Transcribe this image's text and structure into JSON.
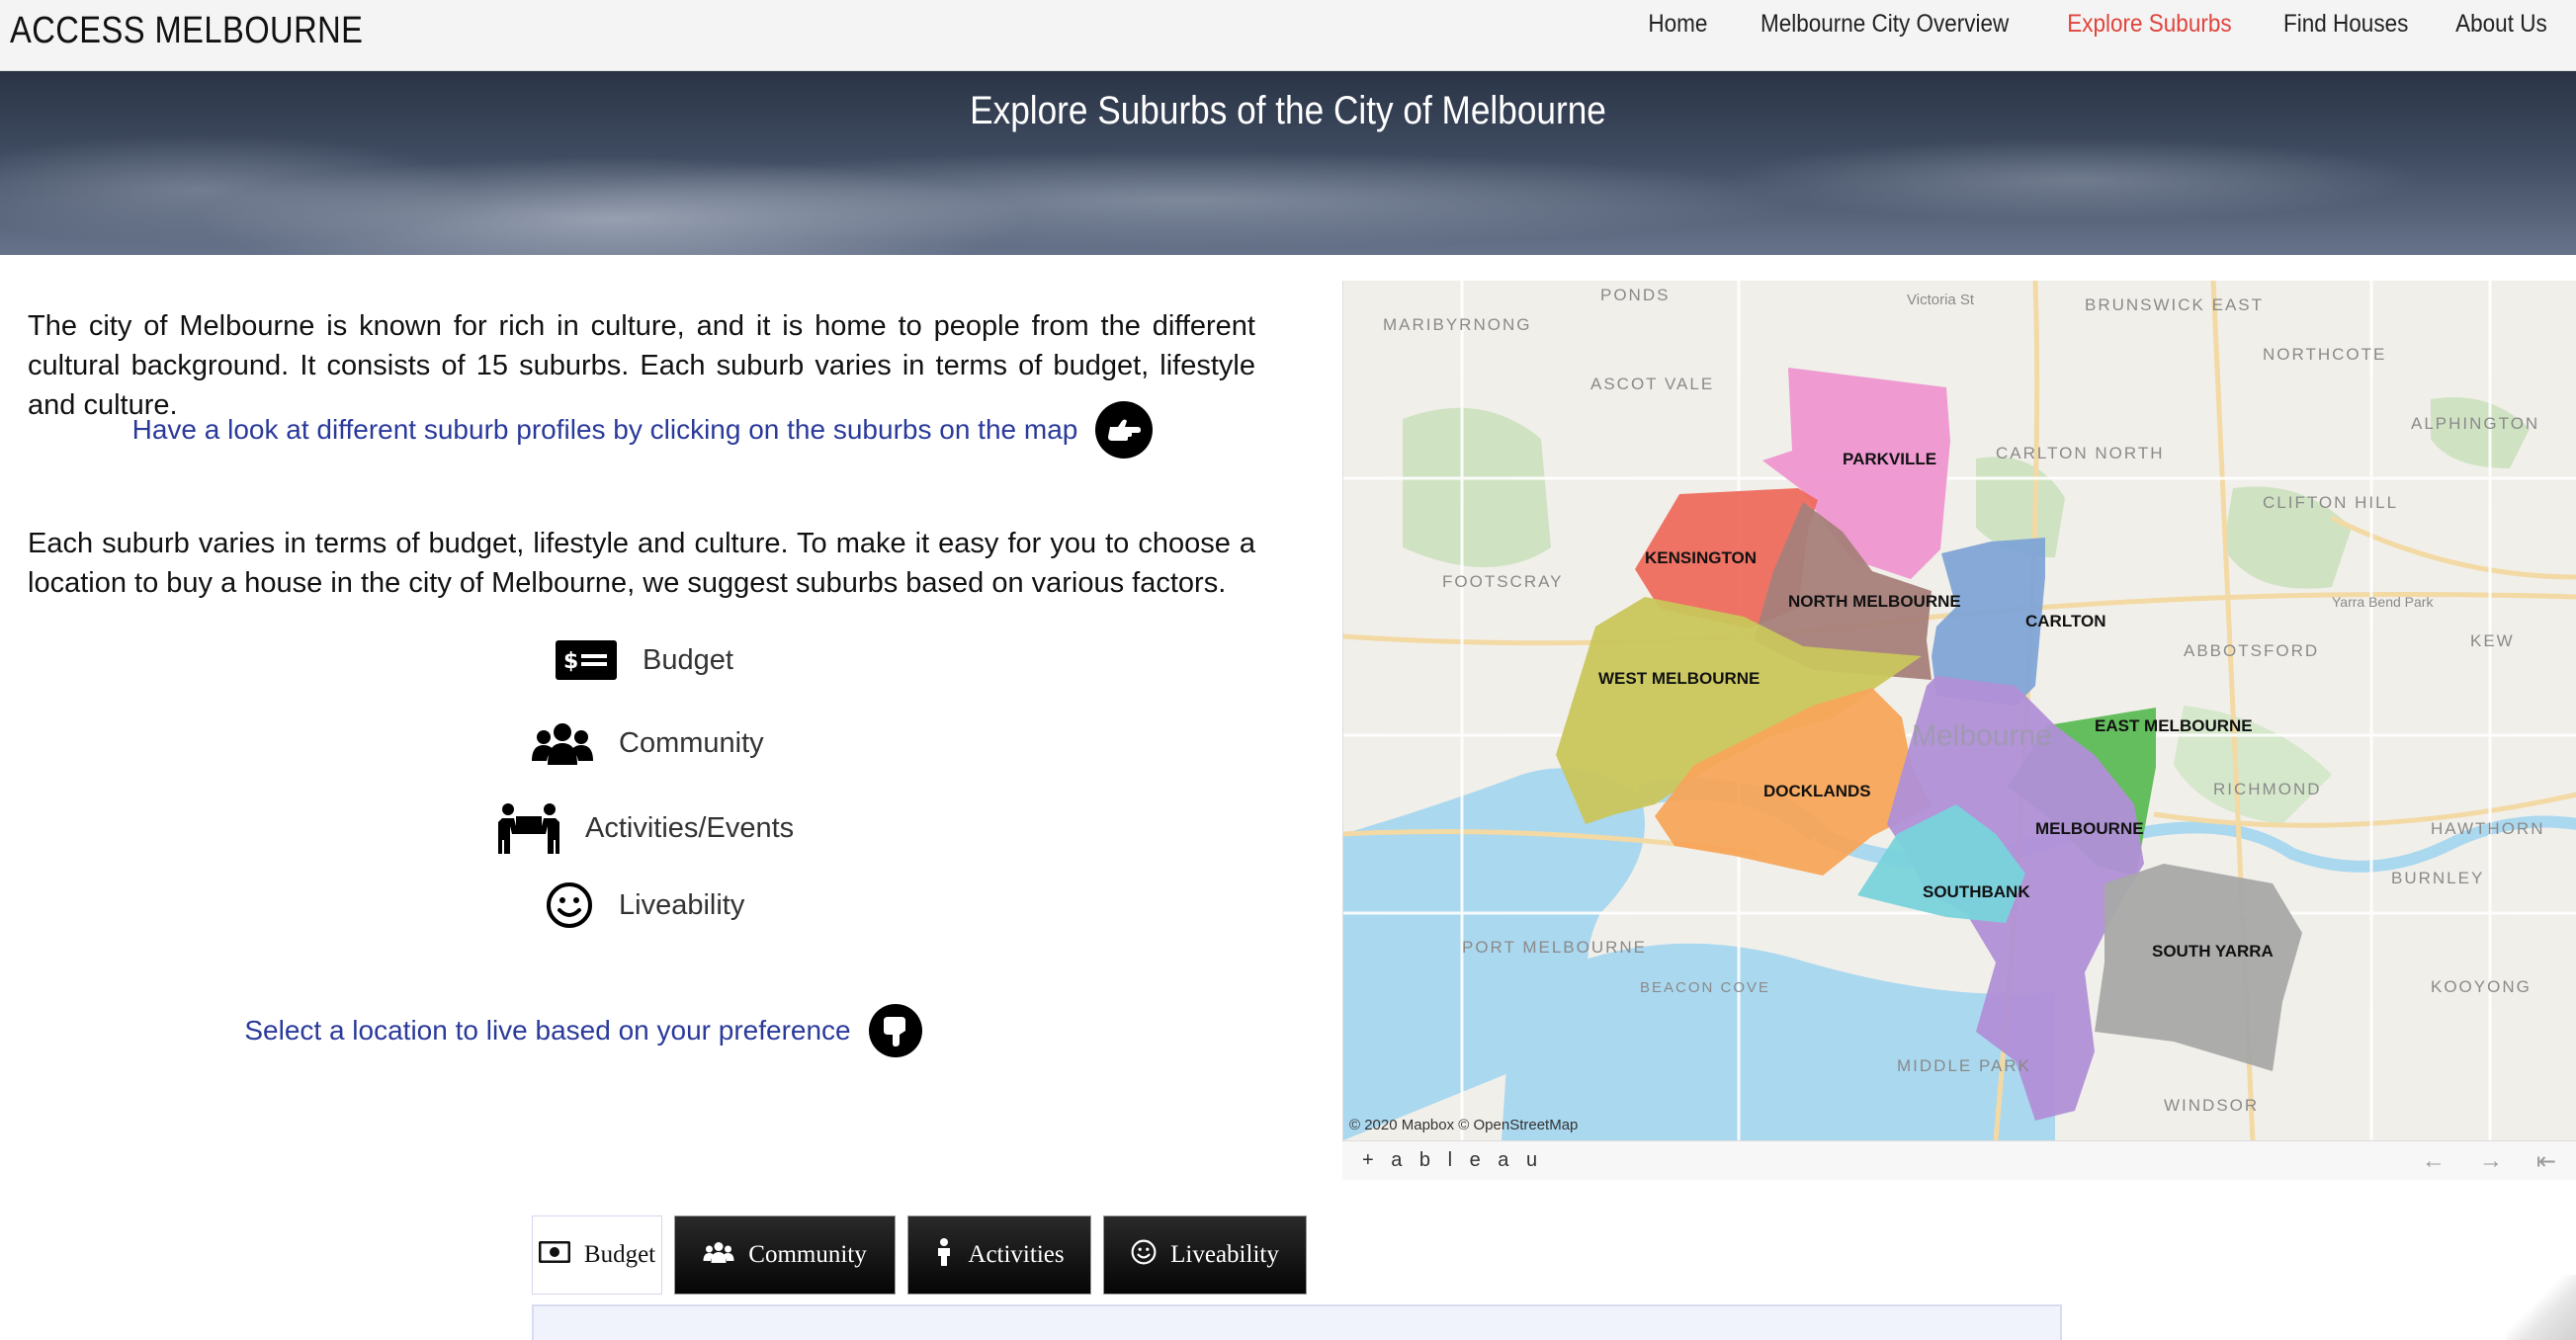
{
  "nav": {
    "brand": "ACCESS MELBOURNE",
    "links": [
      {
        "label": "Home",
        "active": false
      },
      {
        "label": "Melbourne City Overview",
        "active": false
      },
      {
        "label": "Explore Suburbs",
        "active": true
      },
      {
        "label": "Find Houses",
        "active": false
      },
      {
        "label": "About Us",
        "active": false
      }
    ],
    "active_color": "#e0443c"
  },
  "hero": {
    "title": "Explore Suburbs of the City of Melbourne"
  },
  "intro": {
    "text": "The city of Melbourne is known for rich in culture, and it is home to people from the different cultural background. It consists of 15 suburbs. Each suburb varies in terms of budget, lifestyle and culture.",
    "cta": "Have a look at different suburb profiles by clicking on the suburbs on the map",
    "cta_icon": "hand-pointing-right-icon"
  },
  "factors": {
    "text": "Each suburb varies in terms of budget, lifestyle and culture. To make it easy for you to choose a location to buy a house in the city of Melbourne, we suggest suburbs based on various factors.",
    "items": [
      {
        "label": "Budget",
        "icon": "money-bill-icon"
      },
      {
        "label": "Community",
        "icon": "users-icon"
      },
      {
        "label": "Activities/Events",
        "icon": "people-carry-icon"
      },
      {
        "label": "Liveability",
        "icon": "smile-icon"
      }
    ],
    "cta": "Select a location to live based on your preference",
    "cta_icon": "hand-pointing-down-icon"
  },
  "map": {
    "suburbs": [
      {
        "name": "PARKVILLE",
        "color": "#ee95d0"
      },
      {
        "name": "KENSINGTON",
        "color": "#ee6b5e"
      },
      {
        "name": "NORTH MELBOURNE",
        "color": "#a7807a"
      },
      {
        "name": "CARLTON",
        "color": "#7fa4d6"
      },
      {
        "name": "WEST MELBOURNE",
        "color": "#c9c65c"
      },
      {
        "name": "EAST MELBOURNE",
        "color": "#5cbb55"
      },
      {
        "name": "DOCKLANDS",
        "color": "#f7a55a"
      },
      {
        "name": "MELBOURNE",
        "color": "#b08fd6"
      },
      {
        "name": "SOUTHBANK",
        "color": "#79d3db"
      },
      {
        "name": "SOUTH YARRA",
        "color": "#a8a8a8"
      }
    ],
    "basemap_labels": [
      "PONDS",
      "Victoria St",
      "BRUNSWICK EAST",
      "MARIBYRNONG",
      "NORTHCOTE",
      "ASCOT VALE",
      "CARLTON NORTH",
      "CLIFTON HILL",
      "ALPHINGTON",
      "FOOTSCRAY",
      "Yarra Bend Park",
      "ABBOTSFORD",
      "KEW",
      "RICHMOND",
      "HAWTHORN",
      "BURNLEY",
      "PORT MELBOURNE",
      "KOOYONG",
      "MIDDLE PARK",
      "WINDSOR",
      "BEACON COVE",
      "Melbourne"
    ],
    "attribution": "© 2020 Mapbox  © OpenStreetMap",
    "tableau": "+ a b l e a u",
    "nav_icons": [
      "back-arrow-icon",
      "forward-arrow-icon",
      "reset-icon"
    ]
  },
  "tabs": [
    {
      "label": "Budget",
      "icon": "money-bill-icon",
      "active": true
    },
    {
      "label": "Community",
      "icon": "users-icon",
      "active": false
    },
    {
      "label": "Activities",
      "icon": "walker-icon",
      "active": false
    },
    {
      "label": "Liveability",
      "icon": "smile-icon",
      "active": false
    }
  ]
}
